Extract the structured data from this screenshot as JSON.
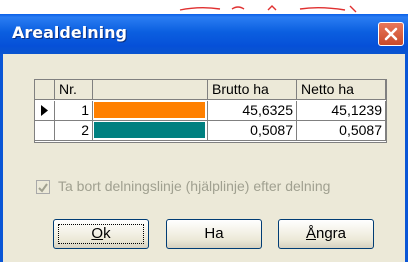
{
  "dialog": {
    "title": "Arealdelning"
  },
  "grid": {
    "columns": [
      "",
      "Nr.",
      "",
      "Brutto ha",
      "Netto ha"
    ],
    "rows": [
      {
        "current": true,
        "nr": "1",
        "color": "#ff8000",
        "brutto": "45,6325",
        "netto": "45,1239"
      },
      {
        "current": false,
        "nr": "2",
        "color": "#008080",
        "brutto": "0,5087",
        "netto": "0,5087"
      }
    ]
  },
  "option": {
    "label": "Ta bort delningslinje (hjälplinje) efter delning",
    "checked": true,
    "enabled": false
  },
  "buttons": {
    "ok": {
      "accel": "O",
      "rest": "k"
    },
    "ha": {
      "label": "Ha"
    },
    "angra": {
      "accel": "Å",
      "rest": "ngra"
    }
  },
  "colors": {
    "titlebar": "#0b5fe0",
    "close": "#d45a35",
    "dialog_bg": "#ece9d8"
  }
}
